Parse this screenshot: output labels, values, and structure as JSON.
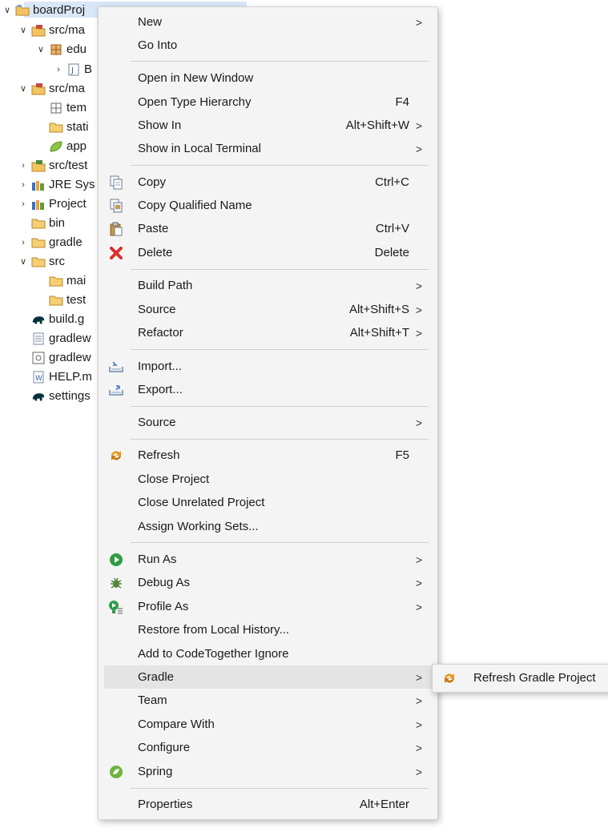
{
  "tree": {
    "items": [
      {
        "label": "boardProj",
        "icon": "project-folder-icon"
      },
      {
        "label": "src/ma",
        "icon": "source-folder-icon"
      },
      {
        "label": "edu",
        "icon": "package-icon"
      },
      {
        "label": "B",
        "icon": "java-file-icon"
      },
      {
        "label": "src/ma",
        "icon": "source-folder-icon"
      },
      {
        "label": "tem",
        "icon": "package-icon"
      },
      {
        "label": "stati",
        "icon": "folder-icon"
      },
      {
        "label": "app",
        "icon": "leaf-icon"
      },
      {
        "label": "src/test",
        "icon": "source-folder-icon"
      },
      {
        "label": "JRE Sys",
        "icon": "library-icon"
      },
      {
        "label": "Project",
        "icon": "library-icon"
      },
      {
        "label": "bin",
        "icon": "folder-icon"
      },
      {
        "label": "gradle",
        "icon": "folder-icon"
      },
      {
        "label": "src",
        "icon": "folder-icon"
      },
      {
        "label": "mai",
        "icon": "folder-icon"
      },
      {
        "label": "test",
        "icon": "folder-icon"
      },
      {
        "label": "build.g",
        "icon": "gradle-elephant-icon"
      },
      {
        "label": "gradlew",
        "icon": "text-file-icon"
      },
      {
        "label": "gradlew",
        "icon": "script-file-icon"
      },
      {
        "label": "HELP.m",
        "icon": "word-file-icon"
      },
      {
        "label": "settings",
        "icon": "gradle-elephant-icon"
      }
    ]
  },
  "menu": {
    "items": [
      {
        "label": "New",
        "accel": "",
        "submenu": true
      },
      {
        "label": "Go Into",
        "accel": "",
        "submenu": false
      },
      {
        "label": "Open in New Window",
        "accel": "",
        "submenu": false
      },
      {
        "label": "Open Type Hierarchy",
        "accel": "F4",
        "submenu": false
      },
      {
        "label": "Show In",
        "accel": "Alt+Shift+W",
        "submenu": true
      },
      {
        "label": "Show in Local Terminal",
        "accel": "",
        "submenu": true
      },
      {
        "label": "Copy",
        "accel": "Ctrl+C",
        "submenu": false,
        "icon": "copy-icon"
      },
      {
        "label": "Copy Qualified Name",
        "accel": "",
        "submenu": false,
        "icon": "copy-qualified-name-icon"
      },
      {
        "label": "Paste",
        "accel": "Ctrl+V",
        "submenu": false,
        "icon": "paste-icon"
      },
      {
        "label": "Delete",
        "accel": "Delete",
        "submenu": false,
        "icon": "delete-icon"
      },
      {
        "label": "Build Path",
        "accel": "",
        "submenu": true
      },
      {
        "label": "Source",
        "accel": "Alt+Shift+S",
        "submenu": true
      },
      {
        "label": "Refactor",
        "accel": "Alt+Shift+T",
        "submenu": true
      },
      {
        "label": "Import...",
        "accel": "",
        "submenu": false,
        "icon": "import-icon"
      },
      {
        "label": "Export...",
        "accel": "",
        "submenu": false,
        "icon": "export-icon"
      },
      {
        "label": "Source",
        "accel": "",
        "submenu": true
      },
      {
        "label": "Refresh",
        "accel": "F5",
        "submenu": false,
        "icon": "refresh-icon"
      },
      {
        "label": "Close Project",
        "accel": "",
        "submenu": false
      },
      {
        "label": "Close Unrelated Project",
        "accel": "",
        "submenu": false
      },
      {
        "label": "Assign Working Sets...",
        "accel": "",
        "submenu": false
      },
      {
        "label": "Run As",
        "accel": "",
        "submenu": true,
        "icon": "run-icon"
      },
      {
        "label": "Debug As",
        "accel": "",
        "submenu": true,
        "icon": "debug-bug-icon"
      },
      {
        "label": "Profile As",
        "accel": "",
        "submenu": true,
        "icon": "profile-icon"
      },
      {
        "label": "Restore from Local History...",
        "accel": "",
        "submenu": false
      },
      {
        "label": "Add to CodeTogether Ignore",
        "accel": "",
        "submenu": false
      },
      {
        "label": "Gradle",
        "accel": "",
        "submenu": true,
        "highlighted": true
      },
      {
        "label": "Team",
        "accel": "",
        "submenu": true
      },
      {
        "label": "Compare With",
        "accel": "",
        "submenu": true
      },
      {
        "label": "Configure",
        "accel": "",
        "submenu": true
      },
      {
        "label": "Spring",
        "accel": "",
        "submenu": true,
        "icon": "spring-icon"
      },
      {
        "label": "Properties",
        "accel": "Alt+Enter",
        "submenu": false
      }
    ],
    "submenu_arrow": ">"
  },
  "submenu": {
    "items": [
      {
        "label": "Refresh Gradle Project",
        "icon": "refresh-icon"
      }
    ]
  },
  "colors": {
    "menu_bg": "#f4f4f4",
    "highlight": "#e4e4e4",
    "selection": "#d9e6f7",
    "delete_red": "#d9302c",
    "run_green": "#2e9d45",
    "refresh_orange": "#e89a1c",
    "spring_green": "#6db33f"
  }
}
